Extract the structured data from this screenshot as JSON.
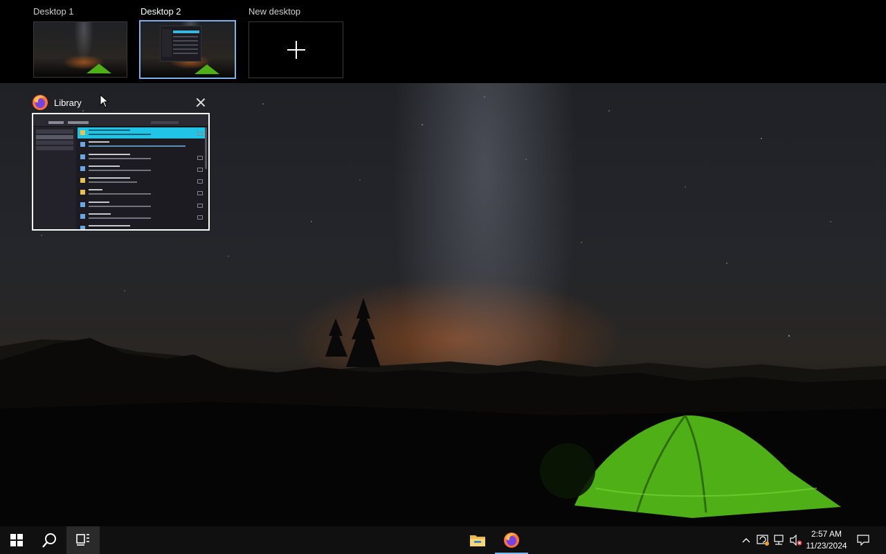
{
  "desktops": [
    {
      "label": "Desktop 1"
    },
    {
      "label": "Desktop 2"
    },
    {
      "label": "New desktop"
    }
  ],
  "active_desktop": "Desktop 2",
  "window_card": {
    "title": "Library",
    "app_icon": "firefox-icon",
    "close_icon": "close-icon"
  },
  "taskbar": {
    "start_icon": "windows-start-icon",
    "search_icon": "search-icon",
    "taskview_icon": "task-view-icon",
    "pinned": [
      {
        "name": "file-explorer-icon"
      },
      {
        "name": "firefox-icon",
        "active": true
      }
    ],
    "tray": {
      "icons": [
        "chevron-up-icon",
        "update-icon",
        "network-icon",
        "volume-muted-icon"
      ],
      "time": "2:57 AM",
      "date": "11/23/2024",
      "notification_icon": "notification-icon"
    }
  },
  "colors": {
    "accent": "#76b9ed",
    "tent": "#4faf17",
    "selection": "#21c3e6"
  }
}
